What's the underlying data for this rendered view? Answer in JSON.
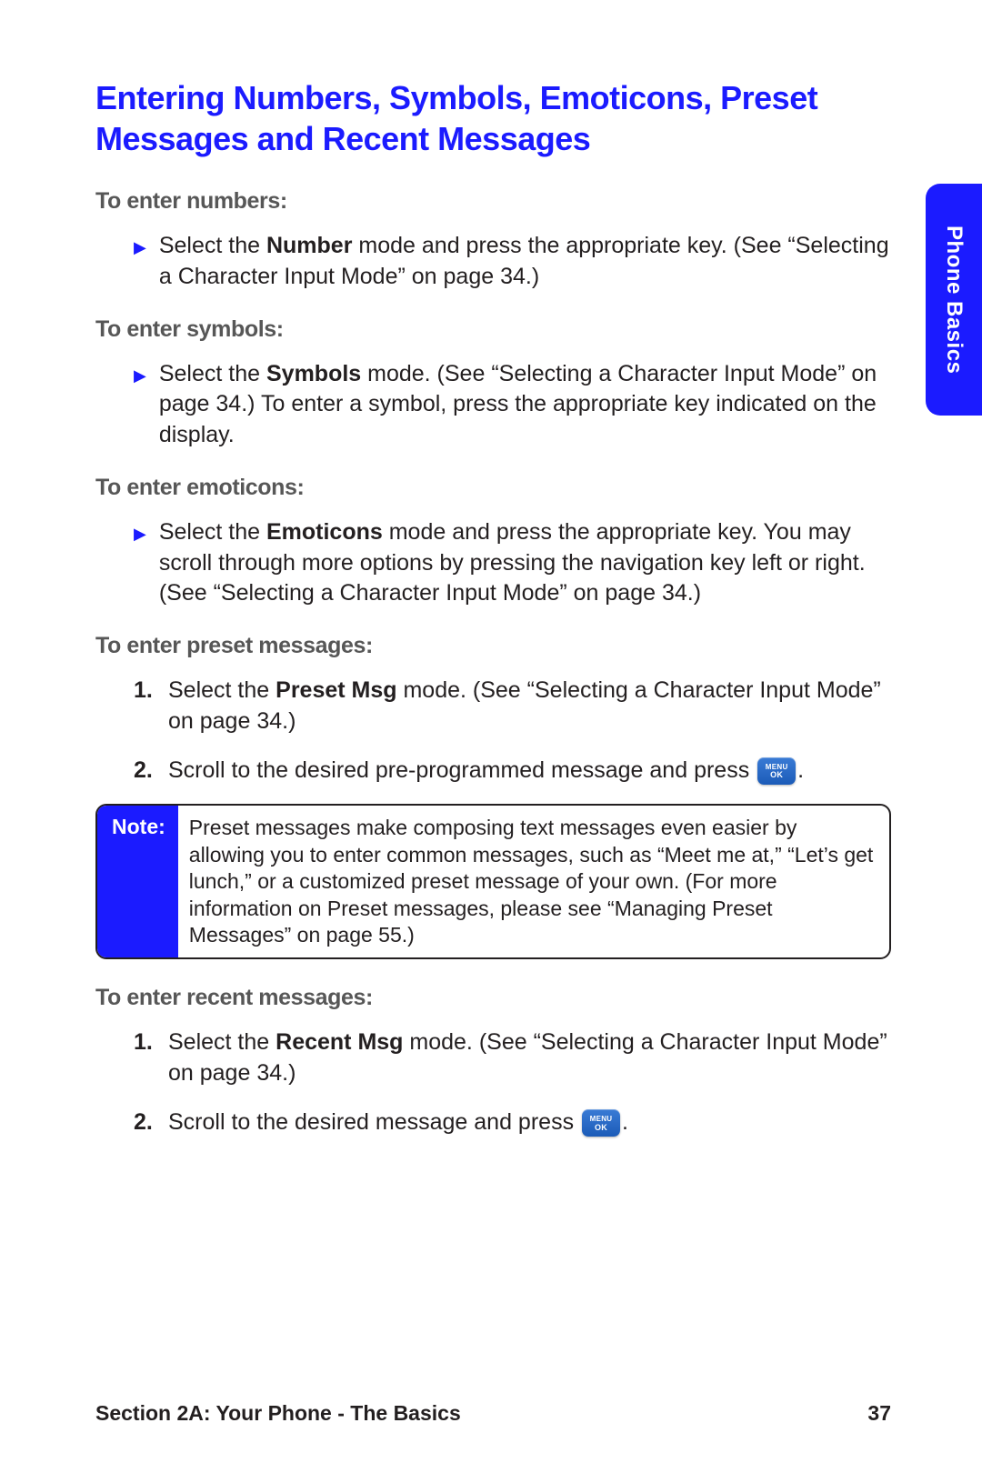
{
  "title": "Entering Numbers, Symbols, Emoticons, Preset Messages and Recent Messages",
  "sideTab": "Phone Basics",
  "sections": {
    "numbers": {
      "heading": "To enter numbers:",
      "bullet_pre": "Select the ",
      "bullet_bold": "Number",
      "bullet_post": " mode and press the appropriate key. (See “Selecting a Character Input Mode” on page 34.)"
    },
    "symbols": {
      "heading": "To enter symbols:",
      "bullet_pre": "Select the ",
      "bullet_bold": "Symbols",
      "bullet_post": " mode. (See “Selecting a Character Input Mode” on page 34.) To enter a symbol, press the appropriate key indicated on the display."
    },
    "emoticons": {
      "heading": "To enter emoticons:",
      "bullet_pre": "Select the ",
      "bullet_bold": "Emoticons",
      "bullet_post": " mode and press the appropriate key. You may scroll through more options by pressing the navigation key left or right. (See “Selecting a Character Input Mode” on page 34.)"
    },
    "preset": {
      "heading": "To enter preset messages:",
      "step1_num": "1.",
      "step1_pre": "Select the ",
      "step1_bold": "Preset Msg",
      "step1_post": " mode. (See “Selecting a Character Input Mode” on page 34.)",
      "step2_num": "2.",
      "step2_pre": "Scroll to the desired pre-programmed message and press ",
      "step2_post": "."
    },
    "recent": {
      "heading": "To enter recent messages:",
      "step1_num": "1.",
      "step1_pre": "Select the ",
      "step1_bold": "Recent Msg",
      "step1_post": " mode. (See “Selecting a Character Input Mode” on page 34.)",
      "step2_num": "2.",
      "step2_pre": "Scroll to the desired message and press ",
      "step2_post": "."
    }
  },
  "note": {
    "label": "Note:",
    "body": "Preset messages make composing text messages even easier by allowing you to enter common messages, such as “Meet me at,” “Let’s get lunch,” or a customized preset message of your own. (For more information on Preset messages, please see “Managing Preset Messages” on page 55.)"
  },
  "menuOk": {
    "line1": "MENU",
    "line2": "OK"
  },
  "footer": {
    "section": "Section 2A: Your Phone - The Basics",
    "page": "37"
  }
}
